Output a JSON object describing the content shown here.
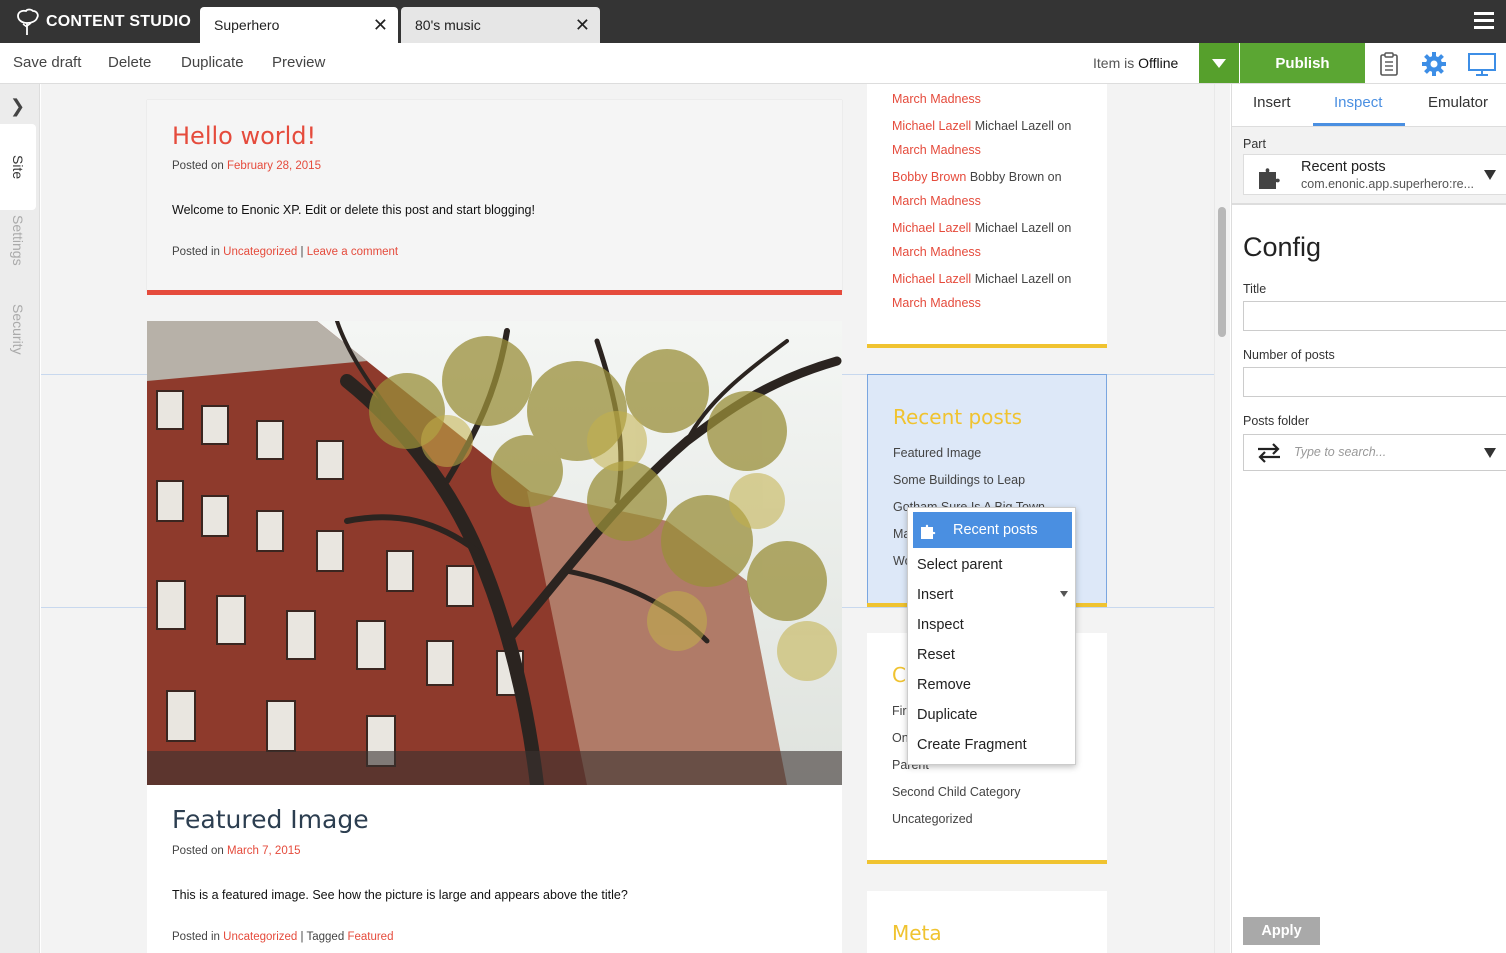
{
  "app": {
    "name": "CONTENT STUDIO"
  },
  "tabs": [
    {
      "label": "Superhero",
      "close": "✕"
    },
    {
      "label": "80's music",
      "close": "✕"
    }
  ],
  "toolbar": {
    "save_draft": "Save draft",
    "delete": "Delete",
    "duplicate": "Duplicate",
    "preview": "Preview",
    "status_prefix": "Item is",
    "status_value": "Offline",
    "publish": "Publish"
  },
  "left_tabs": {
    "site": "Site",
    "settings": "Settings",
    "security": "Security"
  },
  "posts": [
    {
      "title": "Hello world!",
      "posted_on_label": "Posted on",
      "date": "February 28, 2015",
      "body": "Welcome to Enonic XP. Edit or delete this post and start blogging!",
      "posted_in_label": "Posted in",
      "category": "Uncategorized",
      "separator": "|",
      "comment_link": "Leave a comment"
    },
    {
      "title": "Featured Image",
      "posted_on_label": "Posted on",
      "date": "March 7, 2015",
      "body": "This is a featured image. See how the picture is large and appears above the title?",
      "posted_in_label": "Posted in",
      "category": "Uncategorized",
      "separator": "| Tagged",
      "tag": "Featured"
    }
  ],
  "comments_widget": {
    "lines": [
      {
        "link": "March Madness"
      },
      {
        "author": "Michael Lazell",
        "text": "Michael Lazell on"
      },
      {
        "link": "March Madness"
      },
      {
        "author": "Bobby Brown",
        "text": "Bobby Brown on"
      },
      {
        "link": "March Madness"
      },
      {
        "author": "Michael Lazell",
        "text": "Michael Lazell on"
      },
      {
        "link": "March Madness"
      },
      {
        "author": "Michael Lazell",
        "text": "Michael Lazell on"
      },
      {
        "link": "March Madness"
      }
    ]
  },
  "recent_posts_widget": {
    "title": "Recent posts",
    "items": [
      "Featured Image",
      "Some Buildings to Leap",
      "Gotham Sure Is A Big Town",
      "Ma",
      "Wo"
    ]
  },
  "categories_widget": {
    "title_partial": "Ca",
    "items": [
      "Firs",
      "On",
      "Parent",
      "Second Child Category",
      "Uncategorized"
    ]
  },
  "meta_widget": {
    "title": "Meta"
  },
  "context_menu": {
    "header": "Recent posts",
    "items": [
      "Select parent",
      "Insert",
      "Inspect",
      "Reset",
      "Remove",
      "Duplicate",
      "Create Fragment"
    ]
  },
  "right_panel": {
    "tabs": [
      "Insert",
      "Inspect",
      "Emulator"
    ],
    "part_label": "Part",
    "part_name": "Recent posts",
    "part_app": "com.enonic.app.superhero:re...",
    "config_title": "Config",
    "title_label": "Title",
    "title_value": "",
    "num_posts_label": "Number of posts",
    "num_posts_value": "",
    "folder_label": "Posts folder",
    "folder_placeholder": "Type to search...",
    "apply": "Apply"
  },
  "colors": {
    "accent_red": "#e54b3c",
    "widget_yellow": "#f0c330",
    "publish_green": "#5ba633",
    "selection_blue": "#4a8fe1",
    "topbar": "#343434"
  }
}
